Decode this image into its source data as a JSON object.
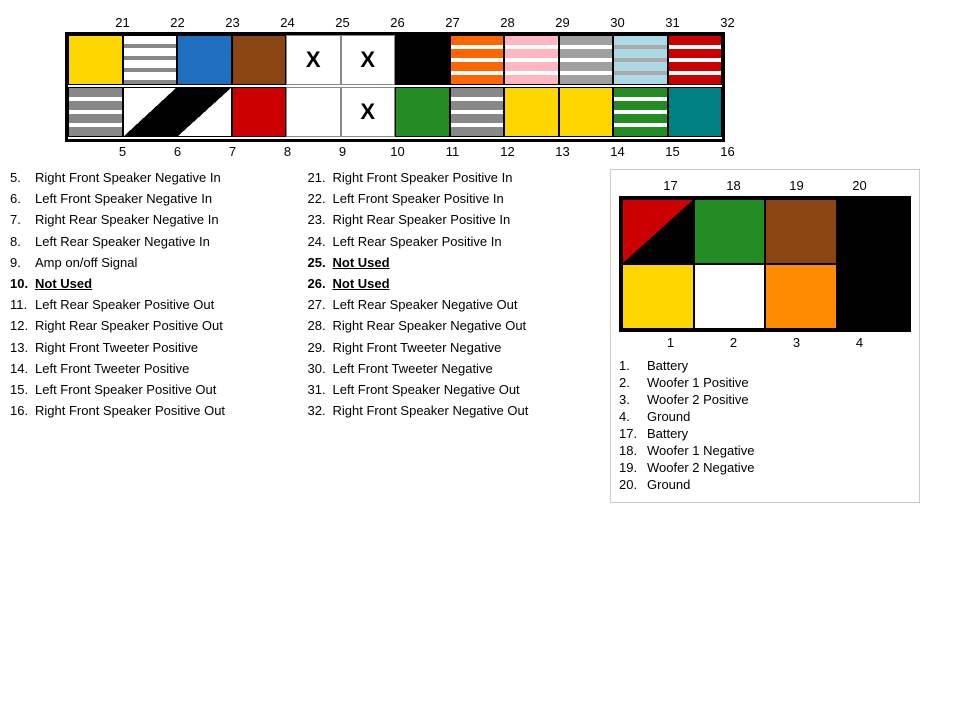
{
  "diagram": {
    "top_pins": [
      "21",
      "22",
      "23",
      "24",
      "25",
      "26",
      "27",
      "28",
      "29",
      "30",
      "31",
      "32"
    ],
    "bottom_pins": [
      "5",
      "6",
      "7",
      "8",
      "9",
      "10",
      "11",
      "12",
      "13",
      "14",
      "15",
      "16"
    ],
    "row1": [
      {
        "color": "yellow",
        "x": false
      },
      {
        "color": "white-gray-stripe",
        "x": false
      },
      {
        "color": "blue",
        "x": false
      },
      {
        "color": "brown",
        "x": false
      },
      {
        "color": "white",
        "x": true
      },
      {
        "color": "white",
        "x": true
      },
      {
        "color": "black",
        "x": false
      },
      {
        "color": "orange-stripe",
        "x": false
      },
      {
        "color": "pink-stripe",
        "x": false
      },
      {
        "color": "gray",
        "x": false
      },
      {
        "color": "lightblue-stripe",
        "x": false
      },
      {
        "color": "red-stripe",
        "x": false
      }
    ],
    "row2": [
      {
        "color": "white-gray-stripe2",
        "x": false
      },
      {
        "color": "diagonal",
        "x": false
      },
      {
        "color": "diagonal-bw",
        "x": false
      },
      {
        "color": "red",
        "x": false
      },
      {
        "color": "white",
        "x": false
      },
      {
        "color": "white",
        "x": true
      },
      {
        "color": "green",
        "x": false
      },
      {
        "color": "gray-stripe",
        "x": false
      },
      {
        "color": "yellow-green",
        "x": false
      },
      {
        "color": "yellow",
        "x": false
      },
      {
        "color": "green-stripe",
        "x": false
      },
      {
        "color": "teal",
        "x": false
      }
    ]
  },
  "small_diagram": {
    "top_pins": [
      "17",
      "18",
      "19",
      "20"
    ],
    "bottom_pins": [
      "1",
      "2",
      "3",
      "4"
    ],
    "row1": [
      {
        "color": "red-triangle"
      },
      {
        "color": "green"
      },
      {
        "color": "brown"
      },
      {
        "color": "black"
      }
    ],
    "row2": [
      {
        "color": "yellow"
      },
      {
        "color": "white"
      },
      {
        "color": "orange"
      },
      {
        "color": "black"
      }
    ]
  },
  "left_legend": [
    {
      "num": "5.",
      "text": "Right Front Speaker Negative In",
      "style": "normal"
    },
    {
      "num": "6.",
      "text": "Left Front Speaker Negative In",
      "style": "normal"
    },
    {
      "num": "7.",
      "text": "Right Rear Speaker Negative In",
      "style": "normal"
    },
    {
      "num": "8.",
      "text": "Left Rear Speaker Negative In",
      "style": "normal"
    },
    {
      "num": "9.",
      "text": "Amp on/off Signal",
      "style": "normal"
    },
    {
      "num": "10.",
      "text": "Not Used",
      "style": "bold-underline"
    },
    {
      "num": "11.",
      "text": "Left Rear Speaker Positive Out",
      "style": "normal"
    },
    {
      "num": "12.",
      "text": "Right Rear Speaker Positive Out",
      "style": "normal"
    },
    {
      "num": "13.",
      "text": "Right Front Tweeter Positive",
      "style": "normal"
    },
    {
      "num": "14.",
      "text": "Left Front Tweeter Positive",
      "style": "normal"
    },
    {
      "num": "15.",
      "text": "Left Front Speaker Positive Out",
      "style": "normal"
    },
    {
      "num": "16.",
      "text": "Right Front Speaker Positive Out",
      "style": "normal"
    }
  ],
  "right_legend": [
    {
      "num": "21.",
      "text": "Right Front Speaker Positive In",
      "style": "normal"
    },
    {
      "num": "22.",
      "text": "Left Front Speaker Positive In",
      "style": "normal"
    },
    {
      "num": "23.",
      "text": "Right Rear Speaker Positive In",
      "style": "normal"
    },
    {
      "num": "24.",
      "text": "Left Rear Speaker Positive In",
      "style": "normal"
    },
    {
      "num": "25.",
      "text": "Not Used",
      "style": "bold-underline"
    },
    {
      "num": "26.",
      "text": "Not Used",
      "style": "bold-underline"
    },
    {
      "num": "27.",
      "text": "Left Rear Speaker Negative Out",
      "style": "normal"
    },
    {
      "num": "28.",
      "text": "Right Rear Speaker Negative Out",
      "style": "normal"
    },
    {
      "num": "29.",
      "text": "Right Front Tweeter Negative",
      "style": "normal"
    },
    {
      "num": "30.",
      "text": "Left Front Tweeter Negative",
      "style": "normal"
    },
    {
      "num": "31.",
      "text": "Left Front Speaker Negative Out",
      "style": "normal"
    },
    {
      "num": "32.",
      "text": "Right Front Speaker Negative Out",
      "style": "normal"
    }
  ],
  "small_legend": [
    {
      "num": "1.",
      "text": "Battery"
    },
    {
      "num": "2.",
      "text": "Woofer 1 Positive"
    },
    {
      "num": "3.",
      "text": "Woofer 2 Positive"
    },
    {
      "num": "4.",
      "text": "Ground"
    },
    {
      "num": "17.",
      "text": "Battery"
    },
    {
      "num": "18.",
      "text": "Woofer 1 Negative"
    },
    {
      "num": "19.",
      "text": "Woofer 2 Negative"
    },
    {
      "num": "20.",
      "text": "Ground"
    }
  ]
}
